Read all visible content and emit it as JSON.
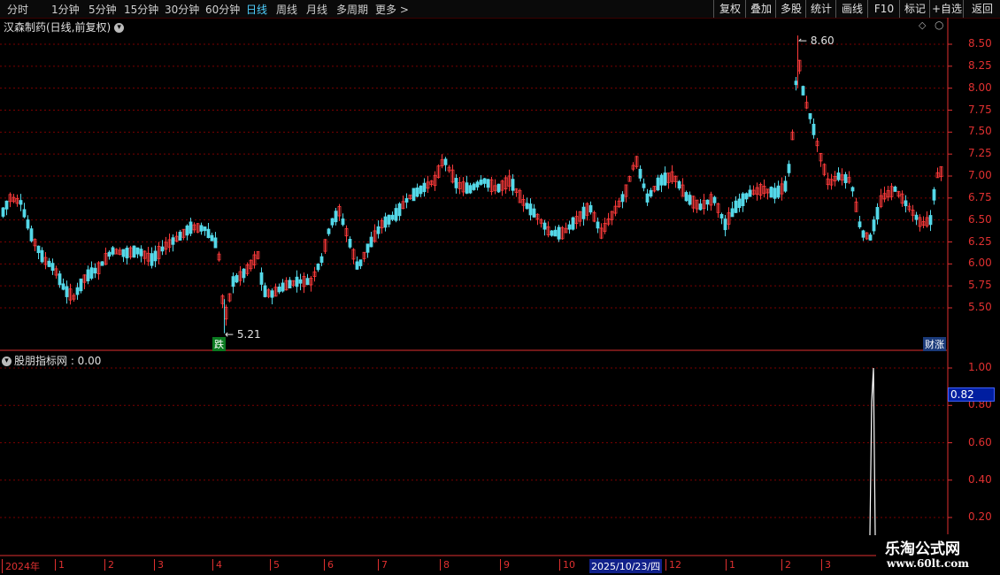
{
  "toolbar": {
    "periods": [
      "分时",
      "1分钟",
      "5分钟",
      "15分钟",
      "30分钟",
      "60分钟",
      "日线",
      "周线",
      "月线",
      "多周期",
      "更多 >"
    ],
    "active_period": "日线",
    "tools": [
      "复权",
      "叠加",
      "多股",
      "统计",
      "画线",
      "F10",
      "标记",
      "+自选",
      "返回"
    ]
  },
  "stock_title": "汉森制药(日线,前复权)",
  "main_chart": {
    "high_label": "8.60",
    "low_label": "5.21",
    "badge_down": "跌",
    "badge_caizhang": "财涨",
    "y_ticks": [
      "8.50",
      "8.25",
      "8.00",
      "7.75",
      "7.50",
      "7.25",
      "7.00",
      "6.75",
      "6.50",
      "6.25",
      "6.00",
      "5.75",
      "5.50"
    ]
  },
  "indicator": {
    "title": "股朋指标网 : 0.00",
    "y_ticks": [
      "1.00",
      "0.80",
      "0.60",
      "0.40",
      "0.20"
    ],
    "current_value": "0.82"
  },
  "time_axis": {
    "labels": [
      "2024年",
      "1",
      "2",
      "3",
      "4",
      "5",
      "6",
      "7",
      "8",
      "9",
      "10",
      "2025/10/23/四",
      "12",
      "1",
      "2",
      "3"
    ]
  },
  "watermark": {
    "line1": "乐淘公式网",
    "line2": "www.60lt.com"
  },
  "colors": {
    "up": "#ff3b3b",
    "down": "#54d8e8",
    "grid": "#7a0000",
    "axis": "#e03030"
  }
}
